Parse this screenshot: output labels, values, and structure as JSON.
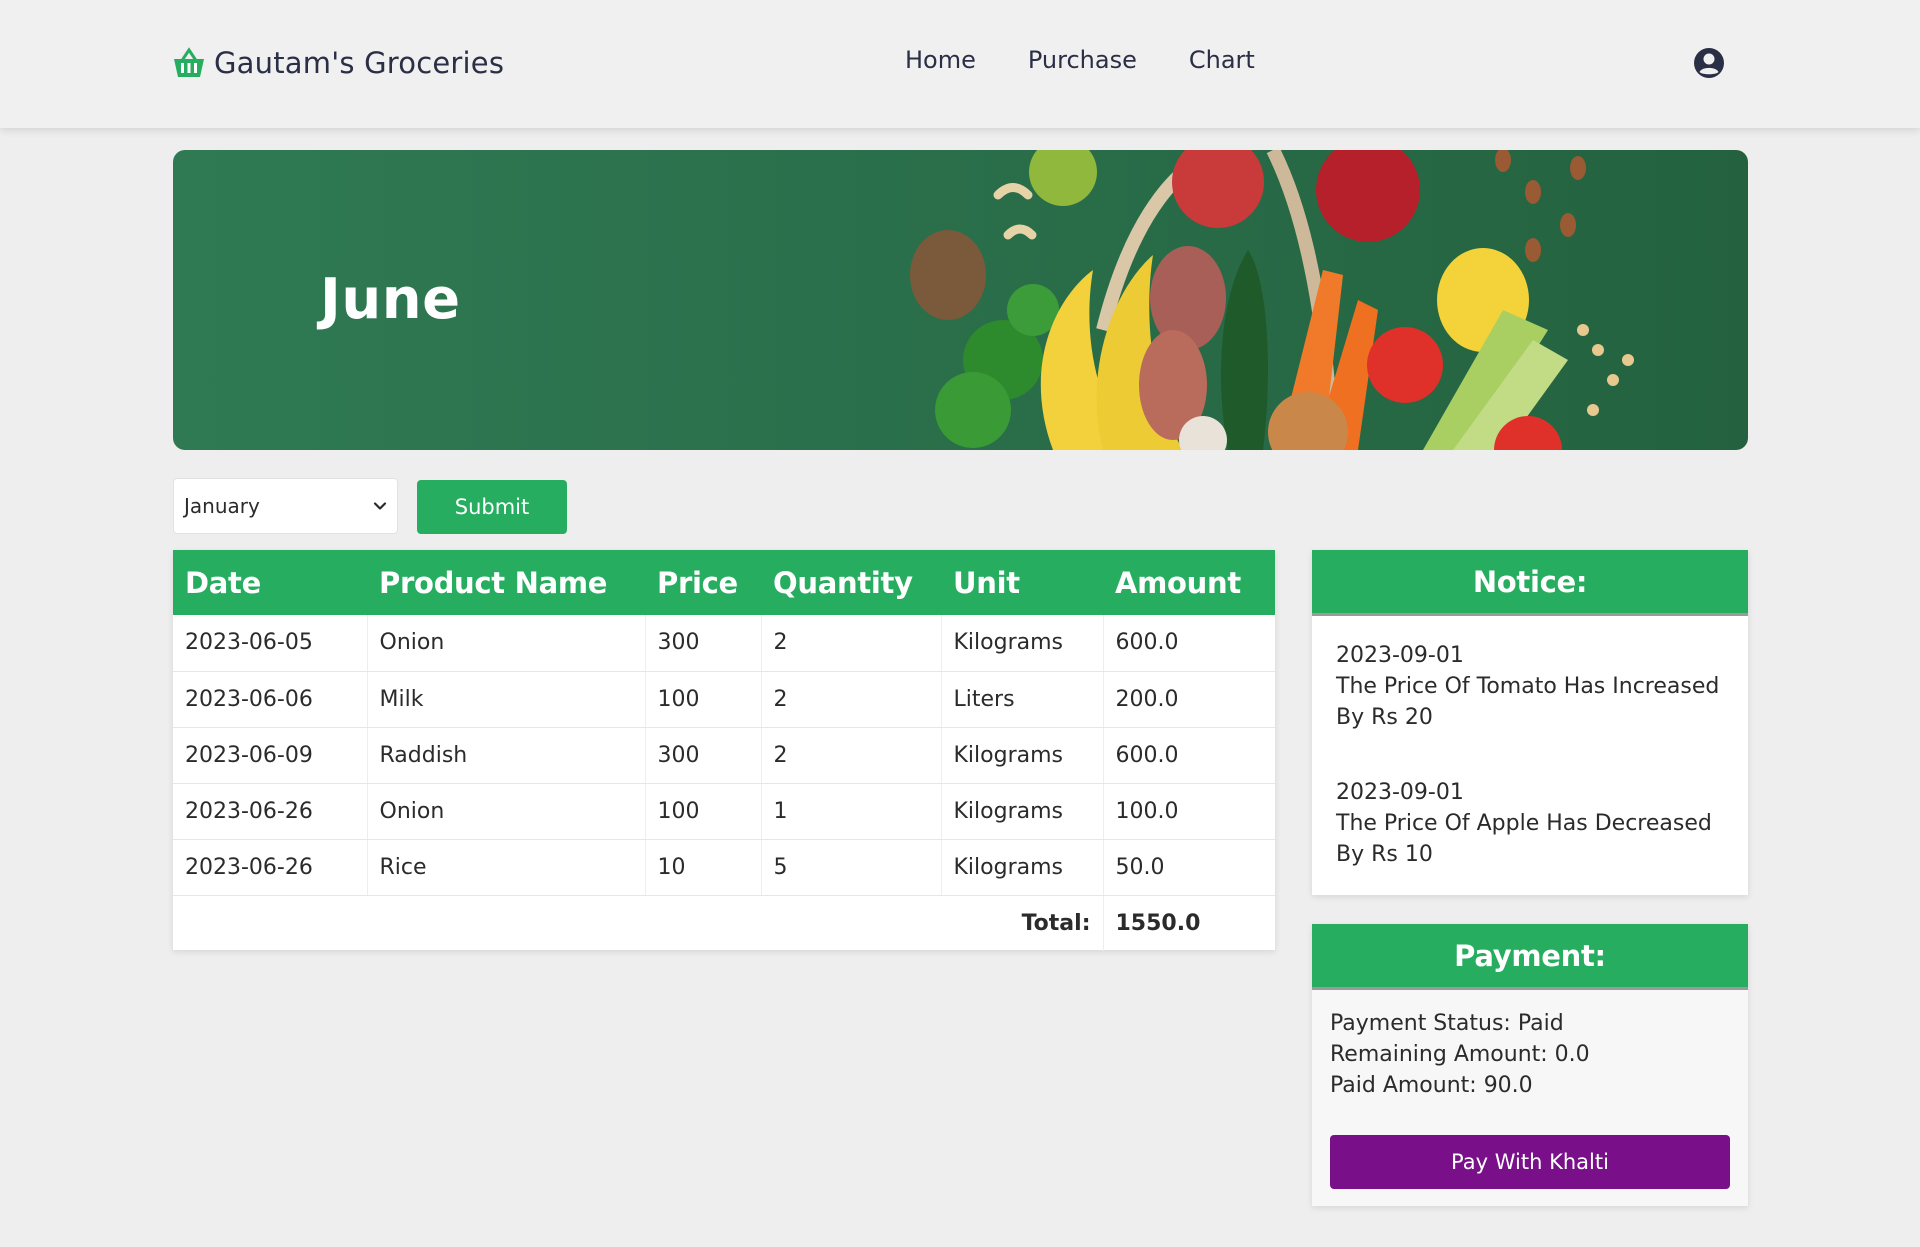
{
  "navbar": {
    "brand": "Gautam's Groceries",
    "links": [
      "Home",
      "Purchase",
      "Chart"
    ]
  },
  "banner": {
    "title": "June"
  },
  "filter": {
    "selected_month": "January",
    "submit_label": "Submit"
  },
  "table": {
    "headers": [
      "Date",
      "Product Name",
      "Price",
      "Quantity",
      "Unit",
      "Amount"
    ],
    "rows": [
      [
        "2023-06-05",
        "Onion",
        "300",
        "2",
        "Kilograms",
        "600.0"
      ],
      [
        "2023-06-06",
        "Milk",
        "100",
        "2",
        "Liters",
        "200.0"
      ],
      [
        "2023-06-09",
        "Raddish",
        "300",
        "2",
        "Kilograms",
        "600.0"
      ],
      [
        "2023-06-26",
        "Onion",
        "100",
        "1",
        "Kilograms",
        "100.0"
      ],
      [
        "2023-06-26",
        "Rice",
        "10",
        "5",
        "Kilograms",
        "50.0"
      ]
    ],
    "total_label": "Total:",
    "total_value": "1550.0"
  },
  "notice": {
    "title": "Notice:",
    "items": [
      {
        "date": "2023-09-01",
        "text": "The Price Of Tomato Has Increased By Rs 20"
      },
      {
        "date": "2023-09-01",
        "text": "The Price Of Apple Has Decreased By Rs 10"
      }
    ]
  },
  "payment": {
    "title": "Payment:",
    "status": "Payment Status: Paid",
    "remaining": "Remaining Amount: 0.0",
    "paid": "Paid Amount: 90.0",
    "button_label": "Pay With Khalti"
  },
  "colors": {
    "accent_green": "#27ad60",
    "khalti_purple": "#7a0f8a",
    "banner_green": "#2a6f4b"
  },
  "icons": [
    "basket-icon",
    "user-circle-icon",
    "chevron-down-icon"
  ]
}
